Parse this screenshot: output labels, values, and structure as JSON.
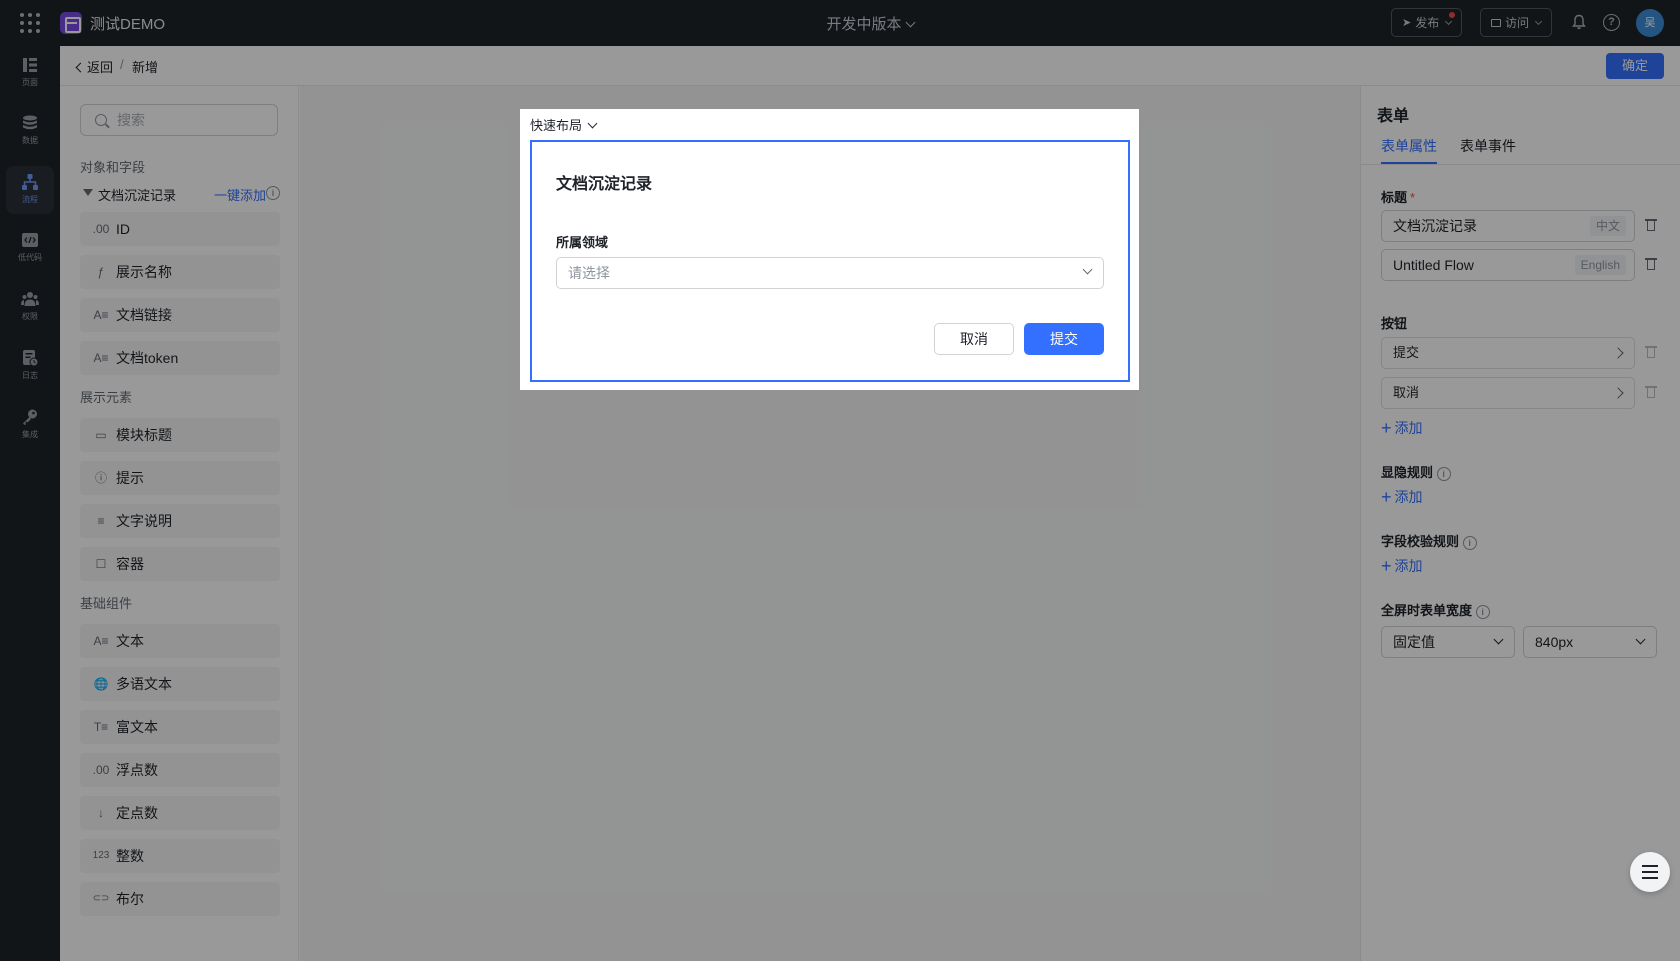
{
  "topbar": {
    "app_name": "测试DEMO",
    "version": "开发中版本",
    "publish": "发布",
    "visit": "访问",
    "avatar": "吴"
  },
  "leftnav": [
    {
      "label": "页面",
      "icon": "pages-icon"
    },
    {
      "label": "数据",
      "icon": "database-icon"
    },
    {
      "label": "流程",
      "icon": "flow-icon",
      "active": true
    },
    {
      "label": "低代码",
      "icon": "code-icon"
    },
    {
      "label": "权限",
      "icon": "users-icon"
    },
    {
      "label": "日志",
      "icon": "log-icon"
    },
    {
      "label": "集成",
      "icon": "key-icon"
    }
  ],
  "header": {
    "back": "返回",
    "separator": "/",
    "current": "新增",
    "confirm": "确定"
  },
  "lpanel": {
    "search_placeholder": "搜索",
    "sec_objects": "对象和字段",
    "object_name": "文档沉淀记录",
    "object_add": "一键添加",
    "fields": [
      {
        "icon": ".00",
        "label": "ID"
      },
      {
        "icon": "ƒ",
        "label": "展示名称"
      },
      {
        "icon": "A≡",
        "label": "文档链接"
      },
      {
        "icon": "A≡",
        "label": "文档token"
      }
    ],
    "sec_display": "展示元素",
    "display": [
      {
        "icon": "▭",
        "label": "模块标题"
      },
      {
        "icon": "ⓘ",
        "label": "提示"
      },
      {
        "icon": "≡",
        "label": "文字说明"
      },
      {
        "icon": "☐",
        "label": "容器"
      }
    ],
    "sec_basic": "基础组件",
    "basic": [
      {
        "icon": "A≡",
        "label": "文本"
      },
      {
        "icon": "🌐",
        "label": "多语文本"
      },
      {
        "icon": "T≡",
        "label": "富文本"
      },
      {
        "icon": ".00",
        "label": "浮点数"
      },
      {
        "icon": "↓",
        "label": "定点数"
      },
      {
        "icon": "123",
        "label": "整数"
      },
      {
        "icon": "⊂⊃",
        "label": "布尔"
      }
    ]
  },
  "rpanel": {
    "title": "表单",
    "tab_props": "表单属性",
    "tab_events": "表单事件",
    "label_title": "标题",
    "required_mark": "*",
    "title_zh": "文档沉淀记录",
    "tag_zh": "中文",
    "title_en": "Untitled Flow",
    "tag_en": "English",
    "label_buttons": "按钮",
    "button_1": "提交",
    "button_2": "取消",
    "add": "添加",
    "label_visibility": "显隐规则",
    "label_validation": "字段校验规则",
    "label_width": "全屏时表单宽度",
    "width_mode": "固定值",
    "width_value": "840px"
  },
  "dialog": {
    "quick_layout": "快速布局",
    "form_title": "文档沉淀记录",
    "field_label": "所属领域",
    "field_placeholder": "请选择",
    "cancel": "取消",
    "submit": "提交"
  }
}
